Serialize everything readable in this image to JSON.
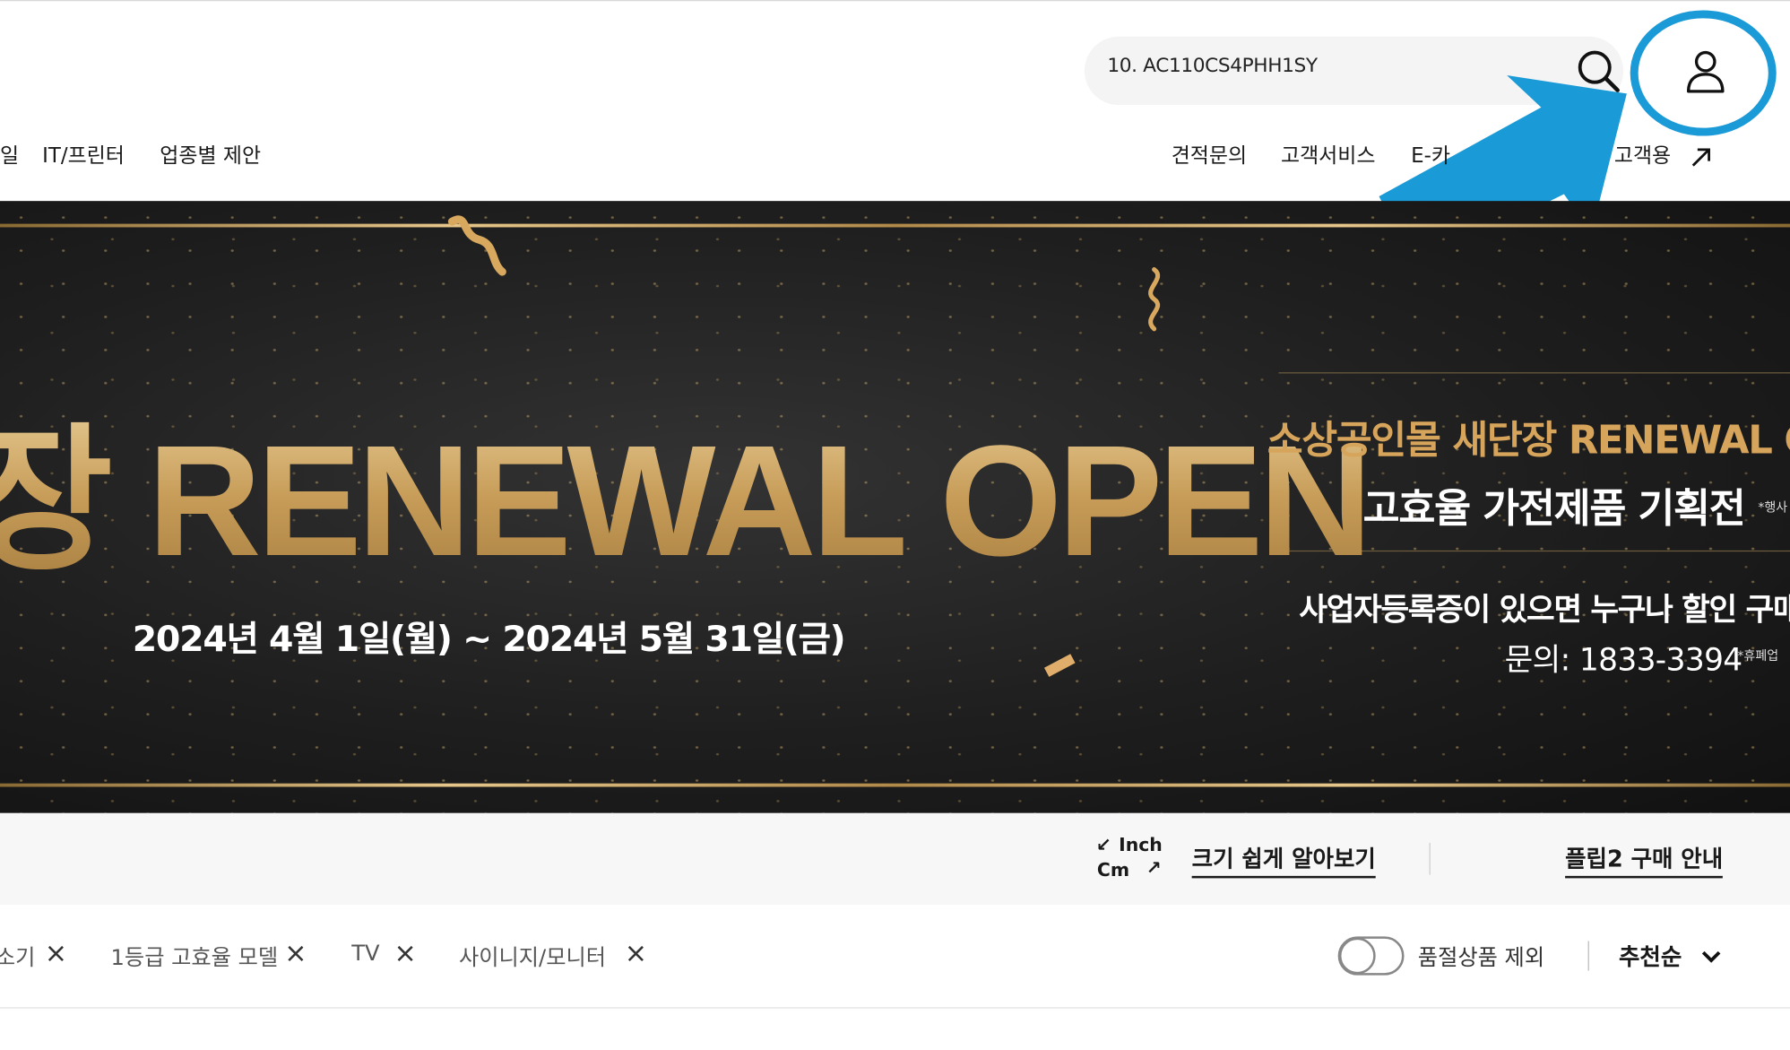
{
  "search": {
    "value": "10. AC110CS4PHH1SY"
  },
  "nav_left": [
    "일",
    "IT/프린터",
    "업종별 제안"
  ],
  "nav_right": [
    "견적문의",
    "고객서비스",
    "E-카",
    "고객용"
  ],
  "banner": {
    "headline": "장 RENEWAL OPEN",
    "date_range": "2024년 4월 1일(월) ~ 2024년 5월 31일(금)",
    "right_title": "소상공인몰 새단장 RENEWAL O",
    "right_sub": "고효율 가전제품 기획전",
    "right_note": "*행사",
    "right_desc": "사업자등록증이 있으면 누구나 할인 구매",
    "right_contact": "문의: 1833-3394",
    "right_note2": "*휴폐업"
  },
  "guide": {
    "inch": "Inch",
    "cm": "Cm",
    "size_guide": "크기 쉽게 알아보기",
    "flip_guide": "플립2 구매 안내"
  },
  "filters": {
    "chips": [
      "소기",
      "1등급 고효율 모델",
      "TV",
      "사이니지/모니터"
    ],
    "soldout_toggle_label": "품절상품 제외",
    "sort_label": "추천순"
  },
  "colors": {
    "highlight": "#1a9ad6",
    "gold": "#c8a466",
    "banner_bg": "#1e1e1e"
  },
  "icons": {
    "search": "search-icon",
    "user": "user-icon",
    "close": "close-icon",
    "chevron": "chevron-down-icon",
    "external": "external-link-icon"
  }
}
